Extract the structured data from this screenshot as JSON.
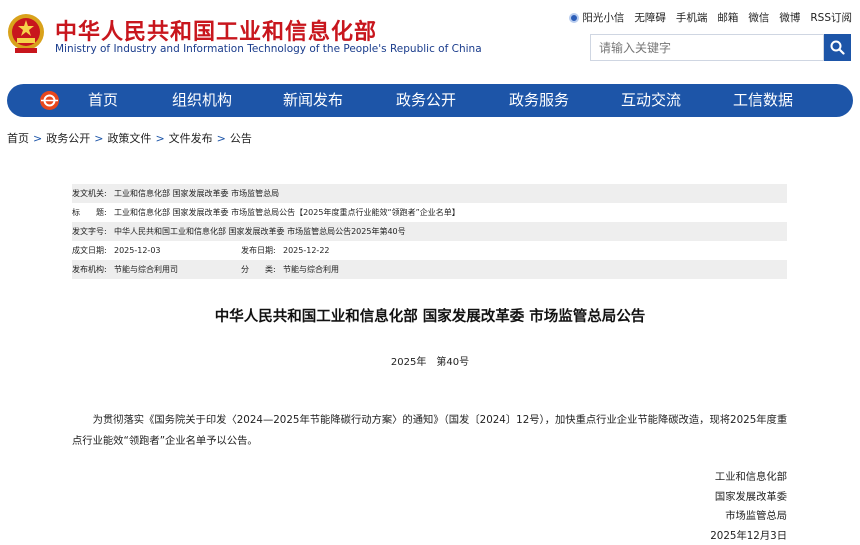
{
  "header": {
    "title_cn": "中华人民共和国工业和信息化部",
    "title_en": "Ministry of Industry and Information Technology of the People's Republic of China",
    "top_links": [
      "阳光小信",
      "无障碍",
      "手机端",
      "邮箱",
      "微信",
      "微博",
      "RSS订阅"
    ],
    "search_placeholder": "请输入关键字"
  },
  "nav": {
    "items": [
      "首页",
      "组织机构",
      "新闻发布",
      "政务公开",
      "政务服务",
      "互动交流",
      "工信数据"
    ]
  },
  "breadcrumb": [
    "首页",
    "政务公开",
    "政策文件",
    "文件发布",
    "公告"
  ],
  "meta": {
    "issuer_label": "发文机关:",
    "issuer": "工业和信息化部 国家发展改革委 市场监管总局",
    "title_label": "标　　题:",
    "title": "工业和信息化部 国家发展改革委 市场监管总局公告【2025年度重点行业能效“领跑者”企业名单】",
    "docno_label": "发文字号:",
    "docno": "中华人民共和国工业和信息化部 国家发展改革委 市场监管总局公告2025年第40号",
    "created_label": "成文日期:",
    "created": "2025-12-03",
    "published_label": "发布日期:",
    "published": "2025-12-22",
    "agency_label": "发布机构:",
    "agency": "节能与综合利用司",
    "category_label": "分　　类:",
    "category": "节能与综合利用"
  },
  "article": {
    "title": "中华人民共和国工业和信息化部 国家发展改革委 市场监管总局公告",
    "number": "2025年　第40号",
    "body": "为贯彻落实《国务院关于印发〈2024—2025年节能降碳行动方案〉的通知》（国发〔2024〕12号），加快重点行业企业节能降碳改造，现将2025年度重点行业能效“领跑者”企业名单予以公告。",
    "signers": [
      "工业和信息化部",
      "国家发展改革委",
      "市场监管总局",
      "2025年12月3日"
    ]
  },
  "colors": {
    "brand_red": "#c8161d",
    "brand_blue": "#1d55a8"
  }
}
